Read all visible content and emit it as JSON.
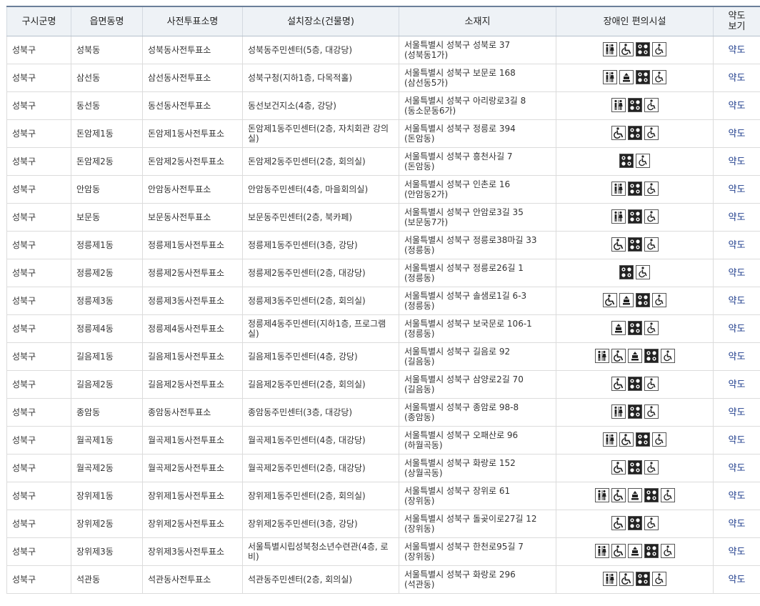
{
  "table": {
    "headers": {
      "district": "구시군명",
      "dong": "읍면동명",
      "station": "사전투표소명",
      "place": "설치장소(건물명)",
      "address": "소재지",
      "facilities": "장애인 편의시설",
      "map_line1": "약도",
      "map_line2": "보기"
    },
    "map_label": "약도",
    "rows": [
      {
        "district": "성북구",
        "dong": "성북동",
        "station": "성북동사전투표소",
        "place": "성북동주민센터(5층, 대강당)",
        "addr1": "서울특별시 성북구 성북로 37",
        "addr2": "(성북동1가)",
        "icons": [
          "toilet",
          "wheelchair",
          "braille",
          "accessible"
        ]
      },
      {
        "district": "성북구",
        "dong": "삼선동",
        "station": "삼선동사전투표소",
        "place": "성북구청(지하1층, 다목적홀)",
        "addr1": "서울특별시 성북구 보문로 168",
        "addr2": "(삼선동5가)",
        "icons": [
          "toilet",
          "elevator",
          "braille",
          "accessible"
        ]
      },
      {
        "district": "성북구",
        "dong": "동선동",
        "station": "동선동사전투표소",
        "place": "동선보건지소(4층, 강당)",
        "addr1": "서울특별시 성북구 아리랑로3길 8",
        "addr2": "(동소문동6가)",
        "icons": [
          "toilet",
          "braille",
          "accessible"
        ]
      },
      {
        "district": "성북구",
        "dong": "돈암제1동",
        "station": "돈암제1동사전투표소",
        "place": "돈암제1동주민센터(2층, 자치회관 강의실)",
        "addr1": "서울특별시 성북구 정릉로 394",
        "addr2": "(돈암동)",
        "icons": [
          "wheelchair",
          "braille",
          "accessible"
        ]
      },
      {
        "district": "성북구",
        "dong": "돈암제2동",
        "station": "돈암제2동사전투표소",
        "place": "돈암제2동주민센터(2층, 회의실)",
        "addr1": "서울특별시 성북구 흥천사길 7",
        "addr2": "(돈암동)",
        "icons": [
          "braille",
          "accessible"
        ]
      },
      {
        "district": "성북구",
        "dong": "안암동",
        "station": "안암동사전투표소",
        "place": "안암동주민센터(4층, 마을회의실)",
        "addr1": "서울특별시 성북구 인촌로 16",
        "addr2": "(안암동2가)",
        "icons": [
          "toilet",
          "braille",
          "accessible"
        ]
      },
      {
        "district": "성북구",
        "dong": "보문동",
        "station": "보문동사전투표소",
        "place": "보문동주민센터(2층, 북카페)",
        "addr1": "서울특별시 성북구 안암로3길 35",
        "addr2": "(보문동7가)",
        "icons": [
          "toilet",
          "braille",
          "accessible"
        ]
      },
      {
        "district": "성북구",
        "dong": "정릉제1동",
        "station": "정릉제1동사전투표소",
        "place": "정릉제1동주민센터(3층, 강당)",
        "addr1": "서울특별시 성북구 정릉로38마길 33",
        "addr2": "(정릉동)",
        "icons": [
          "wheelchair",
          "braille",
          "accessible"
        ]
      },
      {
        "district": "성북구",
        "dong": "정릉제2동",
        "station": "정릉제2동사전투표소",
        "place": "정릉제2동주민센터(2층, 대강당)",
        "addr1": "서울특별시 성북구 정릉로26길 1",
        "addr2": "(정릉동)",
        "icons": [
          "braille",
          "accessible"
        ]
      },
      {
        "district": "성북구",
        "dong": "정릉제3동",
        "station": "정릉제3동사전투표소",
        "place": "정릉제3동주민센터(2층, 회의실)",
        "addr1": "서울특별시 성북구 솔샘로1길 6-3",
        "addr2": "(정릉동)",
        "icons": [
          "wheelchair",
          "elevator",
          "braille",
          "accessible"
        ]
      },
      {
        "district": "성북구",
        "dong": "정릉제4동",
        "station": "정릉제4동사전투표소",
        "place": "정릉제4동주민센터(지하1층, 프로그램실)",
        "addr1": "서울특별시 성북구 보국문로 106-1",
        "addr2": "(정릉동)",
        "icons": [
          "elevator",
          "braille",
          "accessible"
        ]
      },
      {
        "district": "성북구",
        "dong": "길음제1동",
        "station": "길음제1동사전투표소",
        "place": "길음제1동주민센터(4층, 강당)",
        "addr1": "서울특별시 성북구 길음로 92",
        "addr2": "(길음동)",
        "icons": [
          "toilet",
          "wheelchair",
          "elevator",
          "braille",
          "accessible"
        ]
      },
      {
        "district": "성북구",
        "dong": "길음제2동",
        "station": "길음제2동사전투표소",
        "place": "길음제2동주민센터(2층, 회의실)",
        "addr1": "서울특별시 성북구 삼양로2길 70",
        "addr2": "(길음동)",
        "icons": [
          "wheelchair",
          "braille",
          "accessible"
        ]
      },
      {
        "district": "성북구",
        "dong": "종암동",
        "station": "종암동사전투표소",
        "place": "종암동주민센터(3층, 대강당)",
        "addr1": "서울특별시 성북구 종암로 98-8",
        "addr2": "(종암동)",
        "icons": [
          "toilet",
          "braille",
          "accessible"
        ]
      },
      {
        "district": "성북구",
        "dong": "월곡제1동",
        "station": "월곡제1동사전투표소",
        "place": "월곡제1동주민센터(4층, 대강당)",
        "addr1": "서울특별시 성북구 오패산로 96",
        "addr2": "(하월곡동)",
        "icons": [
          "toilet",
          "wheelchair",
          "braille",
          "accessible"
        ]
      },
      {
        "district": "성북구",
        "dong": "월곡제2동",
        "station": "월곡제2동사전투표소",
        "place": "월곡제2동주민센터(2층, 대강당)",
        "addr1": "서울특별시 성북구 화랑로 152",
        "addr2": "(상월곡동)",
        "icons": [
          "wheelchair",
          "braille",
          "accessible"
        ]
      },
      {
        "district": "성북구",
        "dong": "장위제1동",
        "station": "장위제1동사전투표소",
        "place": "장위제1동주민센터(2층, 회의실)",
        "addr1": "서울특별시 성북구 장위로 61",
        "addr2": "(장위동)",
        "icons": [
          "toilet",
          "wheelchair",
          "elevator",
          "braille",
          "accessible"
        ]
      },
      {
        "district": "성북구",
        "dong": "장위제2동",
        "station": "장위제2동사전투표소",
        "place": "장위제2동주민센터(3층, 강당)",
        "addr1": "서울특별시 성북구 돌곶이로27길 12",
        "addr2": "(장위동)",
        "icons": [
          "wheelchair",
          "braille",
          "accessible"
        ]
      },
      {
        "district": "성북구",
        "dong": "장위제3동",
        "station": "장위제3동사전투표소",
        "place": "서울특별시립성북청소년수련관(4층, 로비)",
        "addr1": "서울특별시 성북구 한천로95길 7",
        "addr2": "(장위동)",
        "icons": [
          "toilet",
          "wheelchair",
          "elevator",
          "braille",
          "accessible"
        ]
      },
      {
        "district": "성북구",
        "dong": "석관동",
        "station": "석관동사전투표소",
        "place": "석관동주민센터(2층, 회의실)",
        "addr1": "서울특별시 성북구 화랑로 296",
        "addr2": "(석관동)",
        "icons": [
          "toilet",
          "wheelchair",
          "braille",
          "accessible"
        ]
      }
    ]
  }
}
